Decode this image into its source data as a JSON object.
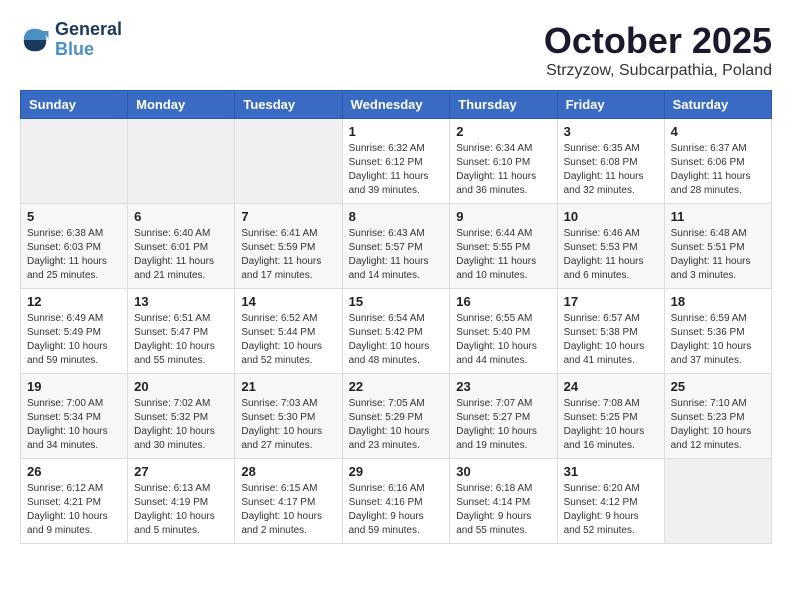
{
  "header": {
    "logo_line1": "General",
    "logo_line2": "Blue",
    "month": "October 2025",
    "location": "Strzyzow, Subcarpathia, Poland"
  },
  "weekdays": [
    "Sunday",
    "Monday",
    "Tuesday",
    "Wednesday",
    "Thursday",
    "Friday",
    "Saturday"
  ],
  "weeks": [
    [
      {
        "day": "",
        "info": ""
      },
      {
        "day": "",
        "info": ""
      },
      {
        "day": "",
        "info": ""
      },
      {
        "day": "1",
        "info": "Sunrise: 6:32 AM\nSunset: 6:12 PM\nDaylight: 11 hours\nand 39 minutes."
      },
      {
        "day": "2",
        "info": "Sunrise: 6:34 AM\nSunset: 6:10 PM\nDaylight: 11 hours\nand 36 minutes."
      },
      {
        "day": "3",
        "info": "Sunrise: 6:35 AM\nSunset: 6:08 PM\nDaylight: 11 hours\nand 32 minutes."
      },
      {
        "day": "4",
        "info": "Sunrise: 6:37 AM\nSunset: 6:06 PM\nDaylight: 11 hours\nand 28 minutes."
      }
    ],
    [
      {
        "day": "5",
        "info": "Sunrise: 6:38 AM\nSunset: 6:03 PM\nDaylight: 11 hours\nand 25 minutes."
      },
      {
        "day": "6",
        "info": "Sunrise: 6:40 AM\nSunset: 6:01 PM\nDaylight: 11 hours\nand 21 minutes."
      },
      {
        "day": "7",
        "info": "Sunrise: 6:41 AM\nSunset: 5:59 PM\nDaylight: 11 hours\nand 17 minutes."
      },
      {
        "day": "8",
        "info": "Sunrise: 6:43 AM\nSunset: 5:57 PM\nDaylight: 11 hours\nand 14 minutes."
      },
      {
        "day": "9",
        "info": "Sunrise: 6:44 AM\nSunset: 5:55 PM\nDaylight: 11 hours\nand 10 minutes."
      },
      {
        "day": "10",
        "info": "Sunrise: 6:46 AM\nSunset: 5:53 PM\nDaylight: 11 hours\nand 6 minutes."
      },
      {
        "day": "11",
        "info": "Sunrise: 6:48 AM\nSunset: 5:51 PM\nDaylight: 11 hours\nand 3 minutes."
      }
    ],
    [
      {
        "day": "12",
        "info": "Sunrise: 6:49 AM\nSunset: 5:49 PM\nDaylight: 10 hours\nand 59 minutes."
      },
      {
        "day": "13",
        "info": "Sunrise: 6:51 AM\nSunset: 5:47 PM\nDaylight: 10 hours\nand 55 minutes."
      },
      {
        "day": "14",
        "info": "Sunrise: 6:52 AM\nSunset: 5:44 PM\nDaylight: 10 hours\nand 52 minutes."
      },
      {
        "day": "15",
        "info": "Sunrise: 6:54 AM\nSunset: 5:42 PM\nDaylight: 10 hours\nand 48 minutes."
      },
      {
        "day": "16",
        "info": "Sunrise: 6:55 AM\nSunset: 5:40 PM\nDaylight: 10 hours\nand 44 minutes."
      },
      {
        "day": "17",
        "info": "Sunrise: 6:57 AM\nSunset: 5:38 PM\nDaylight: 10 hours\nand 41 minutes."
      },
      {
        "day": "18",
        "info": "Sunrise: 6:59 AM\nSunset: 5:36 PM\nDaylight: 10 hours\nand 37 minutes."
      }
    ],
    [
      {
        "day": "19",
        "info": "Sunrise: 7:00 AM\nSunset: 5:34 PM\nDaylight: 10 hours\nand 34 minutes."
      },
      {
        "day": "20",
        "info": "Sunrise: 7:02 AM\nSunset: 5:32 PM\nDaylight: 10 hours\nand 30 minutes."
      },
      {
        "day": "21",
        "info": "Sunrise: 7:03 AM\nSunset: 5:30 PM\nDaylight: 10 hours\nand 27 minutes."
      },
      {
        "day": "22",
        "info": "Sunrise: 7:05 AM\nSunset: 5:29 PM\nDaylight: 10 hours\nand 23 minutes."
      },
      {
        "day": "23",
        "info": "Sunrise: 7:07 AM\nSunset: 5:27 PM\nDaylight: 10 hours\nand 19 minutes."
      },
      {
        "day": "24",
        "info": "Sunrise: 7:08 AM\nSunset: 5:25 PM\nDaylight: 10 hours\nand 16 minutes."
      },
      {
        "day": "25",
        "info": "Sunrise: 7:10 AM\nSunset: 5:23 PM\nDaylight: 10 hours\nand 12 minutes."
      }
    ],
    [
      {
        "day": "26",
        "info": "Sunrise: 6:12 AM\nSunset: 4:21 PM\nDaylight: 10 hours\nand 9 minutes."
      },
      {
        "day": "27",
        "info": "Sunrise: 6:13 AM\nSunset: 4:19 PM\nDaylight: 10 hours\nand 5 minutes."
      },
      {
        "day": "28",
        "info": "Sunrise: 6:15 AM\nSunset: 4:17 PM\nDaylight: 10 hours\nand 2 minutes."
      },
      {
        "day": "29",
        "info": "Sunrise: 6:16 AM\nSunset: 4:16 PM\nDaylight: 9 hours\nand 59 minutes."
      },
      {
        "day": "30",
        "info": "Sunrise: 6:18 AM\nSunset: 4:14 PM\nDaylight: 9 hours\nand 55 minutes."
      },
      {
        "day": "31",
        "info": "Sunrise: 6:20 AM\nSunset: 4:12 PM\nDaylight: 9 hours\nand 52 minutes."
      },
      {
        "day": "",
        "info": ""
      }
    ]
  ]
}
